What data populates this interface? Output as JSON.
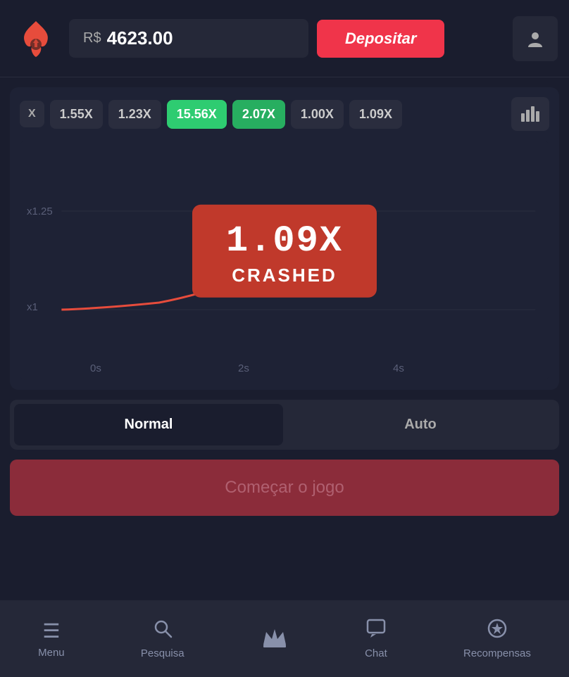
{
  "header": {
    "currency": "R$",
    "balance": "4623.00",
    "deposit_label": "Depositar"
  },
  "multiplier_bar": {
    "x_label": "X",
    "items": [
      {
        "value": "1.55X",
        "style": "gray"
      },
      {
        "value": "1.23X",
        "style": "gray"
      },
      {
        "value": "15.56X",
        "style": "green"
      },
      {
        "value": "2.07X",
        "style": "light-green"
      },
      {
        "value": "1.00X",
        "style": "gray"
      },
      {
        "value": "1.09X",
        "style": "gray"
      }
    ]
  },
  "chart": {
    "y_labels": [
      "x1.25",
      "x1"
    ],
    "x_labels": [
      "0s",
      "2s",
      "4s"
    ],
    "crashed_multiplier": "1.09X",
    "crashed_text": "CRASHED"
  },
  "tabs": {
    "normal": "Normal",
    "auto": "Auto"
  },
  "start_button": "Começar o jogo",
  "bottom_nav": {
    "menu": "Menu",
    "search": "Pesquisa",
    "crown": "",
    "chat": "Chat",
    "rewards": "Recompensas"
  }
}
